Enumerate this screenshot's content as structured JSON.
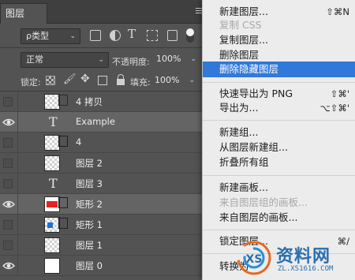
{
  "panel": {
    "tab_label": "图层",
    "filter_label": "ρ类型",
    "blend_mode": "正常",
    "opacity_label": "不透明度:",
    "opacity_value": "100%",
    "lock_label": "锁定:",
    "fill_label": "填充:",
    "fill_value": "100%"
  },
  "layers": [
    {
      "name": "4 拷贝",
      "visible": false,
      "thumb": "transparent",
      "selected": false
    },
    {
      "name": "Example",
      "visible": true,
      "thumb": "text",
      "selected": true
    },
    {
      "name": "4",
      "visible": false,
      "thumb": "transparent",
      "selected": false
    },
    {
      "name": "图层 2",
      "visible": false,
      "thumb": "transparent",
      "selected": false
    },
    {
      "name": "图层 3",
      "visible": false,
      "thumb": "text",
      "selected": false
    },
    {
      "name": "矩形 2",
      "visible": true,
      "thumb": "red-shape",
      "selected": true
    },
    {
      "name": "矩形 1",
      "visible": false,
      "thumb": "blue-shape",
      "selected": false
    },
    {
      "name": "图层 1",
      "visible": false,
      "thumb": "transparent",
      "selected": false
    },
    {
      "name": "图层 0",
      "visible": true,
      "thumb": "white",
      "selected": false
    }
  ],
  "menu": {
    "items": [
      {
        "label": "新建图层...",
        "shortcut": "⇧⌘N",
        "disabled": false,
        "highlighted": false
      },
      {
        "label": "复制 CSS",
        "shortcut": "",
        "disabled": true,
        "highlighted": false
      },
      {
        "label": "复制图层...",
        "shortcut": "",
        "disabled": false,
        "highlighted": false
      },
      {
        "label": "删除图层",
        "shortcut": "",
        "disabled": false,
        "highlighted": false
      },
      {
        "label": "删除隐藏图层",
        "shortcut": "",
        "disabled": false,
        "highlighted": true
      },
      {
        "label": "快速导出为 PNG",
        "shortcut": "⇧⌘'",
        "disabled": false,
        "highlighted": false
      },
      {
        "label": "导出为...",
        "shortcut": "⌥⇧⌘'",
        "disabled": false,
        "highlighted": false
      },
      {
        "label": "新建组...",
        "shortcut": "",
        "disabled": false,
        "highlighted": false
      },
      {
        "label": "从图层新建组...",
        "shortcut": "",
        "disabled": false,
        "highlighted": false
      },
      {
        "label": "折叠所有组",
        "shortcut": "",
        "disabled": false,
        "highlighted": false
      },
      {
        "label": "新建画板...",
        "shortcut": "",
        "disabled": false,
        "highlighted": false
      },
      {
        "label": "来自图层组的画板...",
        "shortcut": "",
        "disabled": true,
        "highlighted": false
      },
      {
        "label": "来自图层的画板...",
        "shortcut": "",
        "disabled": false,
        "highlighted": false
      },
      {
        "label": "锁定图层...",
        "shortcut": "⌘/",
        "disabled": false,
        "highlighted": false
      },
      {
        "label": "转换为",
        "shortcut": "",
        "disabled": false,
        "highlighted": false
      }
    ]
  },
  "watermark": {
    "text": "资料网",
    "url": "ZL.XS1616.COM"
  },
  "colors": {
    "accent": "#3178d9",
    "panel_bg": "#535353",
    "menu_bg": "#ececec",
    "red_shape": "#e8231f",
    "blue_shape": "#1e6fe0"
  }
}
